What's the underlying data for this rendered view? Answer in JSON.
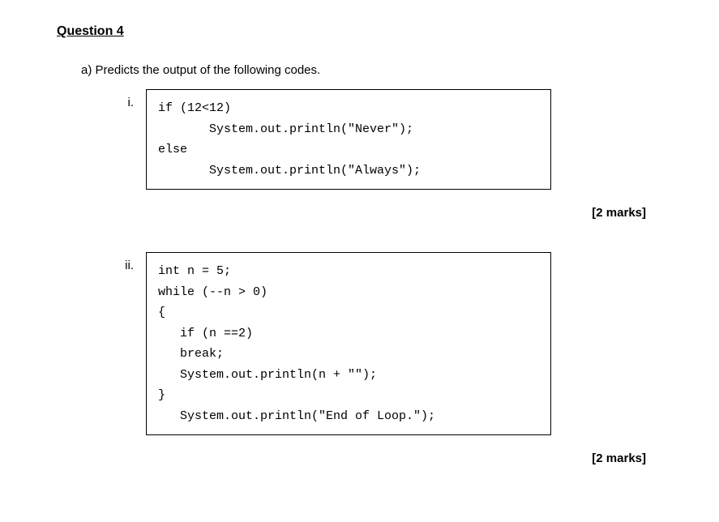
{
  "question": {
    "title": "Question 4",
    "part_a_label": "a)   Predicts the output of the following codes.",
    "subparts": [
      {
        "label": "i.",
        "code": "if (12<12)\n       System.out.println(\"Never\");\nelse\n       System.out.println(\"Always\");",
        "marks": "[2 marks]"
      },
      {
        "label": "ii.",
        "code": "int n = 5;\nwhile (--n > 0)\n{\n   if (n ==2)\n   break;\n   System.out.println(n + \"\");\n}\n   System.out.println(\"End of Loop.\");",
        "marks": "[2 marks]"
      }
    ]
  }
}
